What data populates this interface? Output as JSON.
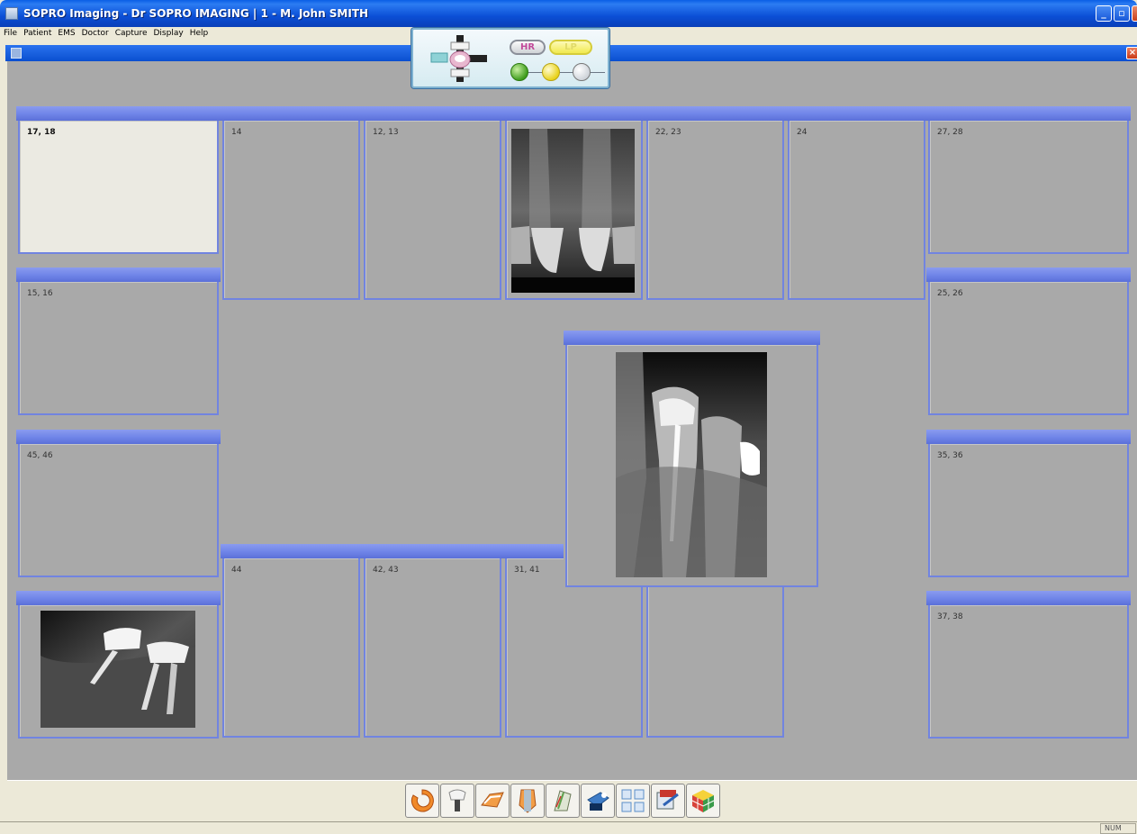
{
  "window": {
    "title": "SOPRO Imaging - Dr SOPRO IMAGING | 1 - M. John SMITH"
  },
  "menu": [
    "File",
    "Patient",
    "EMS",
    "Doctor",
    "Capture",
    "Display",
    "Help"
  ],
  "panel": {
    "hr_label": "HR",
    "lp_label": "LP"
  },
  "tiles": [
    {
      "label": "17, 18",
      "selected": true
    },
    {
      "label": "14"
    },
    {
      "label": "12, 13"
    },
    {
      "label": ""
    },
    {
      "label": "22, 23"
    },
    {
      "label": "24"
    },
    {
      "label": "27, 28"
    },
    {
      "label": "15, 16"
    },
    {
      "label": "25, 26"
    },
    {
      "label": "45, 46"
    },
    {
      "label": "35, 36"
    },
    {
      "label": ""
    },
    {
      "label": "44"
    },
    {
      "label": "42, 43"
    },
    {
      "label": "31, 41"
    },
    {
      "label": ""
    },
    {
      "label": "37, 38"
    },
    {
      "label": ""
    }
  ],
  "toolbar": {
    "icons": [
      "endo-icon",
      "implant-icon",
      "occlusal-icon",
      "tooth-profile-icon",
      "periodontal-icon",
      "hygiene-icon",
      "layout-grid-icon",
      "export-icon",
      "color-cube-icon"
    ]
  },
  "status": {
    "num": "NUM"
  },
  "colors": {
    "title_bar": "#0a4fd0",
    "tile_header": "#6f84e8",
    "workspace": "#a9a9a9",
    "toolbar": "#ece9d8"
  }
}
